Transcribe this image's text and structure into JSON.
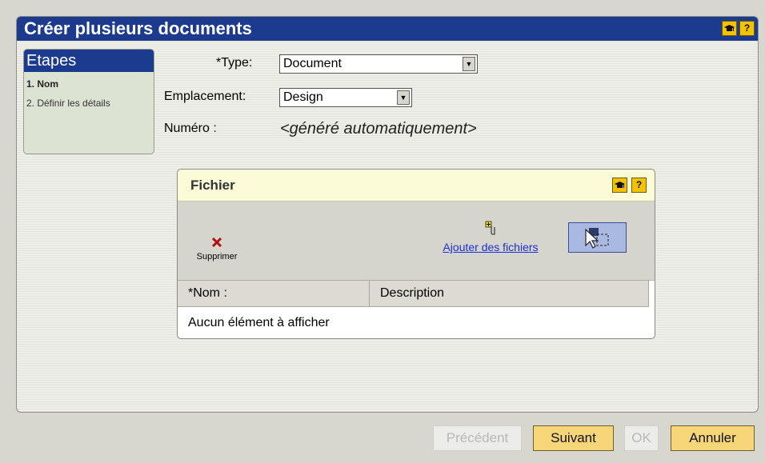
{
  "dialog": {
    "title": "Créer plusieurs documents",
    "help_icon": "mortarboard-icon",
    "question_icon": "question-icon",
    "question_label": "?"
  },
  "steps": {
    "title": "Etapes",
    "items": [
      {
        "label": "1. Nom",
        "active": true
      },
      {
        "label": "2. Définir les détails",
        "active": false
      }
    ]
  },
  "form": {
    "type_label": "*Type:",
    "type_value": "Document",
    "location_label": "Emplacement:",
    "location_value": "Design",
    "number_label": "Numéro :",
    "number_value": "<généré automatiquement>"
  },
  "files_panel": {
    "title": "Fichier",
    "delete_label": "Supprimer",
    "add_files_label": "Ajouter des fichiers",
    "columns": [
      "*Nom :",
      "Description"
    ],
    "empty_message": "Aucun élément à afficher"
  },
  "buttons": {
    "previous": "Précédent",
    "next": "Suivant",
    "ok": "OK",
    "cancel": "Annuler"
  },
  "colors": {
    "title_bar": "#1c3b8f",
    "button_active": "#f6d678",
    "help_button": "#f4c200"
  }
}
